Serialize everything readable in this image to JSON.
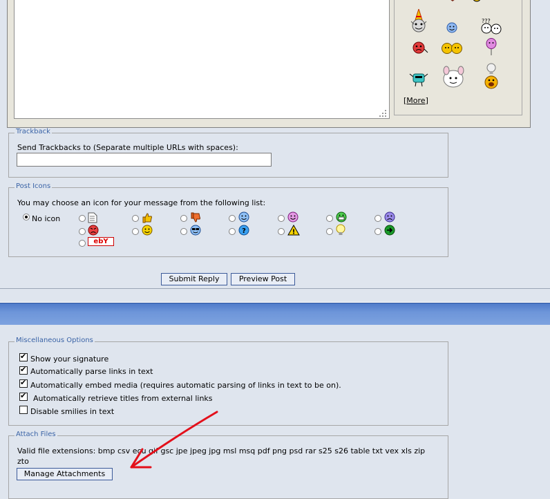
{
  "smilies": {
    "more_link": "More",
    "items": [
      "party-hat-smilie-icon",
      "blue-happy-smilie-icon",
      "confused-question-smilie-icon",
      "angry-red-smilie-icon",
      "two-faces-smilie-icon",
      "purple-balloon-smilie-icon",
      "cyan-robot-smilie-icon",
      "white-creature-smilie-icon",
      "lightbulb-idea-smilie-icon"
    ]
  },
  "trackback": {
    "legend": "Trackback",
    "label": "Send Trackbacks to (Separate multiple URLs with spaces):",
    "value": ""
  },
  "post_icons": {
    "legend": "Post Icons",
    "intro": "You may choose an icon for your message from the following list:",
    "no_icon_label": "No icon",
    "selected": "no-icon",
    "icons": [
      "document-icon",
      "thumbs-up-icon",
      "thumbs-down-icon",
      "smile-icon",
      "grin-icon",
      "big-grin-icon",
      "frown-icon",
      "angry-icon",
      "happy-icon",
      "cool-icon",
      "question-icon",
      "warning-icon",
      "lightbulb-icon",
      "arrow-right-icon",
      "ebay-icon"
    ],
    "ebay_text": "ebY"
  },
  "actions": {
    "submit_label": "Submit Reply",
    "preview_label": "Preview Post"
  },
  "misc_options": {
    "legend": "Miscellaneous Options",
    "options": [
      {
        "label": "Show your signature",
        "checked": true
      },
      {
        "label": "Automatically parse links in text",
        "checked": true
      },
      {
        "label": "Automatically embed media (requires automatic parsing of links in text to be on).",
        "checked": true
      },
      {
        "label": "Automatically retrieve titles from external links",
        "checked": true
      },
      {
        "label": "Disable smilies in text",
        "checked": false
      }
    ]
  },
  "attach": {
    "legend": "Attach Files",
    "extensions": "Valid file extensions: bmp csv ecu gif gsc jpe jpeg jpg msl msq pdf png psd rar s25 s26 table txt vex xls zip zto",
    "manage_label": "Manage Attachments"
  },
  "colors": {
    "background": "#dfe5ee",
    "legend_text": "#3a63a6",
    "button_border": "#3b5a99",
    "header_band": "#4f7bc9",
    "annotation_arrow": "#e3101b"
  }
}
